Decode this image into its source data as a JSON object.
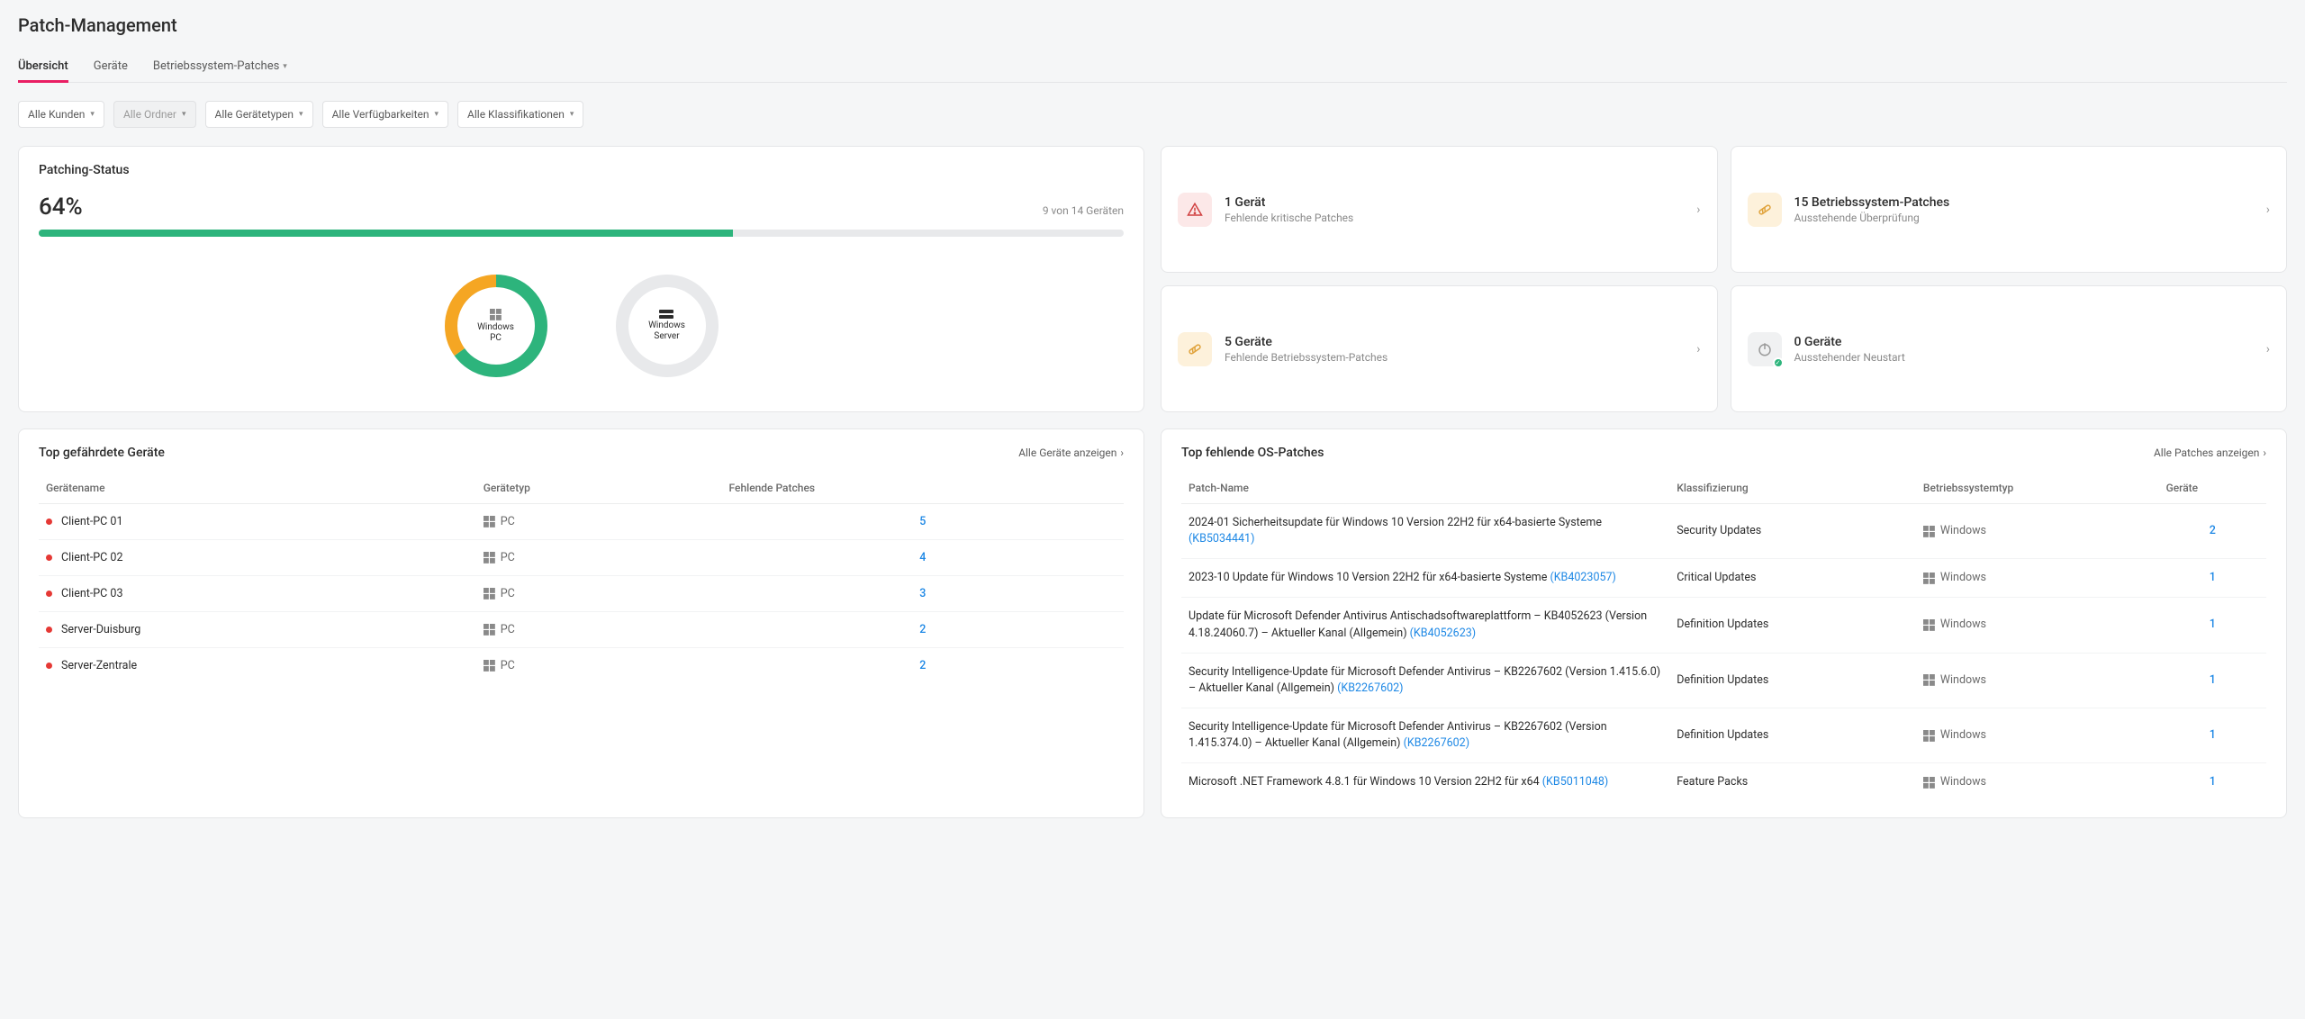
{
  "page": {
    "title": "Patch-Management"
  },
  "tabs": [
    {
      "label": "Übersicht",
      "active": true
    },
    {
      "label": "Geräte",
      "active": false
    },
    {
      "label": "Betriebssystem-Patches",
      "active": false,
      "dropdown": true
    }
  ],
  "filters": [
    {
      "label": "Alle Kunden",
      "disabled": false
    },
    {
      "label": "Alle Ordner",
      "disabled": true
    },
    {
      "label": "Alle Gerätetypen",
      "disabled": false
    },
    {
      "label": "Alle Verfügbarkeiten",
      "disabled": false
    },
    {
      "label": "Alle Klassifikationen",
      "disabled": false
    }
  ],
  "status": {
    "title": "Patching-Status",
    "percent_label": "64%",
    "percent_value": 64,
    "count_text": "9 von 14 Geräten",
    "donuts": [
      {
        "label_line1": "Windows",
        "label_line2": "PC",
        "green": 65,
        "orange": 35,
        "icon": "windows"
      },
      {
        "label_line1": "Windows",
        "label_line2": "Server",
        "green": 0,
        "orange": 0,
        "icon": "server"
      }
    ]
  },
  "summary_cards": [
    {
      "icon": "warning",
      "icon_class": "ic-red",
      "title": "1 Gerät",
      "sub": "Fehlende kritische Patches",
      "chevron": true
    },
    {
      "icon": "patch",
      "icon_class": "ic-orange",
      "title": "15 Betriebssystem-Patches",
      "sub": "Ausstehende Überprüfung",
      "chevron": true
    },
    {
      "icon": "patch",
      "icon_class": "ic-orange",
      "title": "5 Geräte",
      "sub": "Fehlende Betriebssystem-Patches",
      "chevron": true
    },
    {
      "icon": "power",
      "icon_class": "ic-gray",
      "title": "0 Geräte",
      "sub": "Ausstehender Neustart",
      "chevron": true,
      "badge": true
    }
  ],
  "devices": {
    "title": "Top gefährdete Geräte",
    "view_all": "Alle Geräte anzeigen",
    "cols": {
      "name": "Gerätename",
      "type": "Gerätetyp",
      "missing": "Fehlende Patches"
    },
    "rows": [
      {
        "name": "Client-PC 01",
        "type": "PC",
        "missing": "5"
      },
      {
        "name": "Client-PC 02",
        "type": "PC",
        "missing": "4"
      },
      {
        "name": "Client-PC 03",
        "type": "PC",
        "missing": "3"
      },
      {
        "name": "Server-Duisburg",
        "type": "PC",
        "missing": "2"
      },
      {
        "name": "Server-Zentrale",
        "type": "PC",
        "missing": "2"
      }
    ]
  },
  "patches": {
    "title": "Top fehlende OS-Patches",
    "view_all": "Alle Patches anzeigen",
    "cols": {
      "name": "Patch-Name",
      "class": "Klassifizierung",
      "ostype": "Betriebssystemtyp",
      "devices": "Geräte"
    },
    "rows": [
      {
        "name": "2024-01 Sicherheitsupdate für Windows 10 Version 22H2 für x64-basierte Systeme ",
        "kb": "(KB5034441)",
        "class": "Security Updates",
        "os": "Windows",
        "devices": "2"
      },
      {
        "name": "2023-10 Update für Windows 10 Version 22H2 für x64-basierte Systeme ",
        "kb": "(KB4023057)",
        "class": "Critical Updates",
        "os": "Windows",
        "devices": "1"
      },
      {
        "name": "Update für Microsoft Defender Antivirus Antischadsoftwareplattform – KB4052623 (Version 4.18.24060.7) – Aktueller Kanal (Allgemein) ",
        "kb": "(KB4052623)",
        "class": "Definition Updates",
        "os": "Windows",
        "devices": "1"
      },
      {
        "name": "Security Intelligence-Update für Microsoft Defender Antivirus – KB2267602 (Version 1.415.6.0) – Aktueller Kanal (Allgemein) ",
        "kb": "(KB2267602)",
        "class": "Definition Updates",
        "os": "Windows",
        "devices": "1"
      },
      {
        "name": "Security Intelligence-Update für Microsoft Defender Antivirus – KB2267602 (Version 1.415.374.0) – Aktueller Kanal (Allgemein) ",
        "kb": "(KB2267602)",
        "class": "Definition Updates",
        "os": "Windows",
        "devices": "1"
      },
      {
        "name": "Microsoft .NET Framework 4.8.1 für Windows 10 Version 22H2 für x64 ",
        "kb": "(KB5011048)",
        "class": "Feature Packs",
        "os": "Windows",
        "devices": "1"
      }
    ]
  },
  "chart_data": {
    "type": "bar",
    "title": "Patching-Status",
    "categories": [
      "Windows PC",
      "Windows Server"
    ],
    "series": [
      {
        "name": "grün",
        "values": [
          65,
          0
        ]
      },
      {
        "name": "orange",
        "values": [
          35,
          0
        ]
      },
      {
        "name": "grau (kein Daten)",
        "values": [
          0,
          100
        ]
      }
    ],
    "overall_percent": 64,
    "overall_count": "9 von 14 Geräten"
  }
}
